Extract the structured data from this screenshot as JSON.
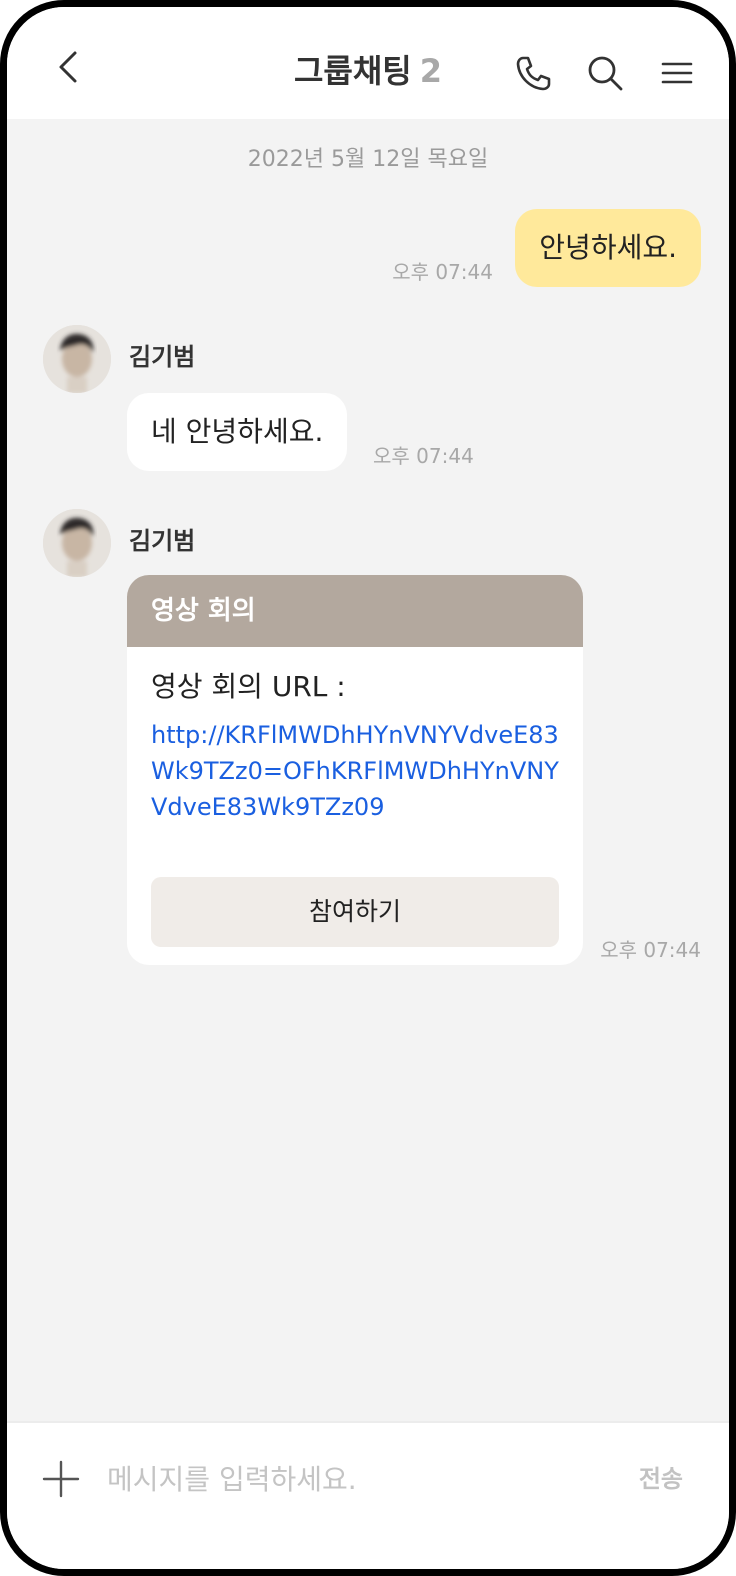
{
  "header": {
    "title": "그룹채팅",
    "member_count": "2",
    "icons": [
      "chevron-left-icon",
      "phone-icon",
      "search-icon",
      "hamburger-menu-icon"
    ]
  },
  "chat": {
    "date_divider": "2022년 5월 12일 목요일",
    "messages": [
      {
        "from": "me",
        "text": "안녕하세요.",
        "time": "오후 07:44"
      },
      {
        "from": "other",
        "sender": "김기범",
        "text": "네 안녕하세요.",
        "time": "오후 07:44"
      },
      {
        "from": "other",
        "sender": "김기범",
        "card": {
          "header": "영상 회의",
          "label": "영상 회의 URL :",
          "url": "http://KRFlMWDhHYnVNYVdveE83Wk9TZz0=OFhKRFlMWDhHYnVNYVdveE83Wk9TZz09",
          "button": "참여하기"
        },
        "time": "오후 07:44"
      }
    ]
  },
  "input_bar": {
    "placeholder": "메시지를 입력하세요.",
    "value": "",
    "send_label": "전송",
    "icons": [
      "plus-icon"
    ]
  },
  "colors": {
    "my_bubble": "#ffe99b",
    "card_header": "#b3a89e",
    "link": "#1a5fe0",
    "chat_background": "#f3f3f3"
  }
}
